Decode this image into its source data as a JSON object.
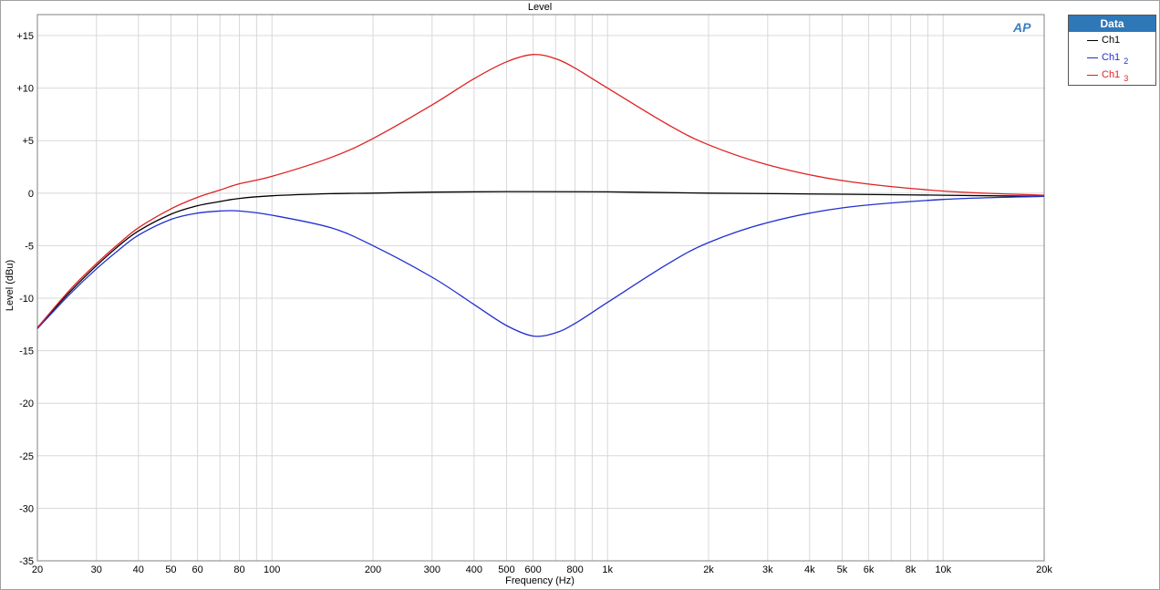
{
  "chart_data": {
    "type": "line",
    "title": "Level",
    "xlabel": "Frequency (Hz)",
    "ylabel": "Level (dBu)",
    "xscale": "log",
    "xlim": [
      20,
      20000
    ],
    "ylim": [
      -35,
      17
    ],
    "x_ticks": [
      {
        "value": 20,
        "label": "20"
      },
      {
        "value": 30,
        "label": "30"
      },
      {
        "value": 40,
        "label": "40"
      },
      {
        "value": 50,
        "label": "50"
      },
      {
        "value": 60,
        "label": "60"
      },
      {
        "value": 80,
        "label": "80"
      },
      {
        "value": 100,
        "label": "100"
      },
      {
        "value": 200,
        "label": "200"
      },
      {
        "value": 300,
        "label": "300"
      },
      {
        "value": 400,
        "label": "400"
      },
      {
        "value": 500,
        "label": "500"
      },
      {
        "value": 600,
        "label": "600"
      },
      {
        "value": 800,
        "label": "800"
      },
      {
        "value": 1000,
        "label": "1k"
      },
      {
        "value": 2000,
        "label": "2k"
      },
      {
        "value": 3000,
        "label": "3k"
      },
      {
        "value": 4000,
        "label": "4k"
      },
      {
        "value": 5000,
        "label": "5k"
      },
      {
        "value": 6000,
        "label": "6k"
      },
      {
        "value": 8000,
        "label": "8k"
      },
      {
        "value": 10000,
        "label": "10k"
      },
      {
        "value": 20000,
        "label": "20k"
      }
    ],
    "y_ticks": [
      {
        "value": 15,
        "label": "+15"
      },
      {
        "value": 10,
        "label": "+10"
      },
      {
        "value": 5,
        "label": "+5"
      },
      {
        "value": 0,
        "label": "0"
      },
      {
        "value": -5,
        "label": "-5"
      },
      {
        "value": -10,
        "label": "-10"
      },
      {
        "value": -15,
        "label": "-15"
      },
      {
        "value": -20,
        "label": "-20"
      },
      {
        "value": -25,
        "label": "-25"
      },
      {
        "value": -30,
        "label": "-30"
      },
      {
        "value": -35,
        "label": "-35"
      }
    ],
    "grid": true,
    "legend_position": "top-right, outside plot",
    "series": [
      {
        "name": "Ch1",
        "color": "#000000",
        "points": [
          [
            20,
            -12.8
          ],
          [
            25,
            -9.4
          ],
          [
            30,
            -6.9
          ],
          [
            35,
            -5.0
          ],
          [
            40,
            -3.6
          ],
          [
            50,
            -2.0
          ],
          [
            60,
            -1.2
          ],
          [
            70,
            -0.8
          ],
          [
            80,
            -0.5
          ],
          [
            100,
            -0.25
          ],
          [
            150,
            -0.05
          ],
          [
            200,
            0.0
          ],
          [
            300,
            0.1
          ],
          [
            500,
            0.15
          ],
          [
            1000,
            0.12
          ],
          [
            2000,
            0.0
          ],
          [
            5000,
            -0.1
          ],
          [
            10000,
            -0.2
          ],
          [
            20000,
            -0.3
          ]
        ]
      },
      {
        "name": "Ch1 2",
        "color": "#1f2fd0",
        "points": [
          [
            20,
            -12.9
          ],
          [
            25,
            -9.6
          ],
          [
            30,
            -7.2
          ],
          [
            35,
            -5.4
          ],
          [
            40,
            -4.0
          ],
          [
            50,
            -2.5
          ],
          [
            60,
            -1.9
          ],
          [
            70,
            -1.7
          ],
          [
            80,
            -1.7
          ],
          [
            100,
            -2.1
          ],
          [
            150,
            -3.3
          ],
          [
            200,
            -5.0
          ],
          [
            300,
            -8.0
          ],
          [
            400,
            -10.6
          ],
          [
            500,
            -12.6
          ],
          [
            600,
            -13.6
          ],
          [
            700,
            -13.3
          ],
          [
            800,
            -12.4
          ],
          [
            1000,
            -10.4
          ],
          [
            1500,
            -6.8
          ],
          [
            2000,
            -4.7
          ],
          [
            3000,
            -2.8
          ],
          [
            5000,
            -1.4
          ],
          [
            10000,
            -0.6
          ],
          [
            20000,
            -0.3
          ]
        ]
      },
      {
        "name": "Ch1 3",
        "color": "#e02020",
        "points": [
          [
            20,
            -12.8
          ],
          [
            25,
            -9.2
          ],
          [
            30,
            -6.7
          ],
          [
            35,
            -4.8
          ],
          [
            40,
            -3.3
          ],
          [
            50,
            -1.5
          ],
          [
            60,
            -0.4
          ],
          [
            70,
            0.3
          ],
          [
            80,
            0.9
          ],
          [
            100,
            1.6
          ],
          [
            150,
            3.4
          ],
          [
            200,
            5.2
          ],
          [
            300,
            8.4
          ],
          [
            400,
            10.9
          ],
          [
            500,
            12.5
          ],
          [
            600,
            13.2
          ],
          [
            700,
            12.8
          ],
          [
            800,
            11.9
          ],
          [
            1000,
            10.0
          ],
          [
            1500,
            6.6
          ],
          [
            2000,
            4.6
          ],
          [
            3000,
            2.7
          ],
          [
            5000,
            1.2
          ],
          [
            10000,
            0.2
          ],
          [
            20000,
            -0.2
          ]
        ]
      }
    ]
  },
  "legend": {
    "header": "Data",
    "items": [
      {
        "label": "Ch1",
        "sub": "",
        "color": "#000000"
      },
      {
        "label": "Ch1",
        "sub": "2",
        "color": "#1f2fd0"
      },
      {
        "label": "Ch1",
        "sub": "3",
        "color": "#e02020"
      }
    ]
  },
  "logo_text": "AP"
}
